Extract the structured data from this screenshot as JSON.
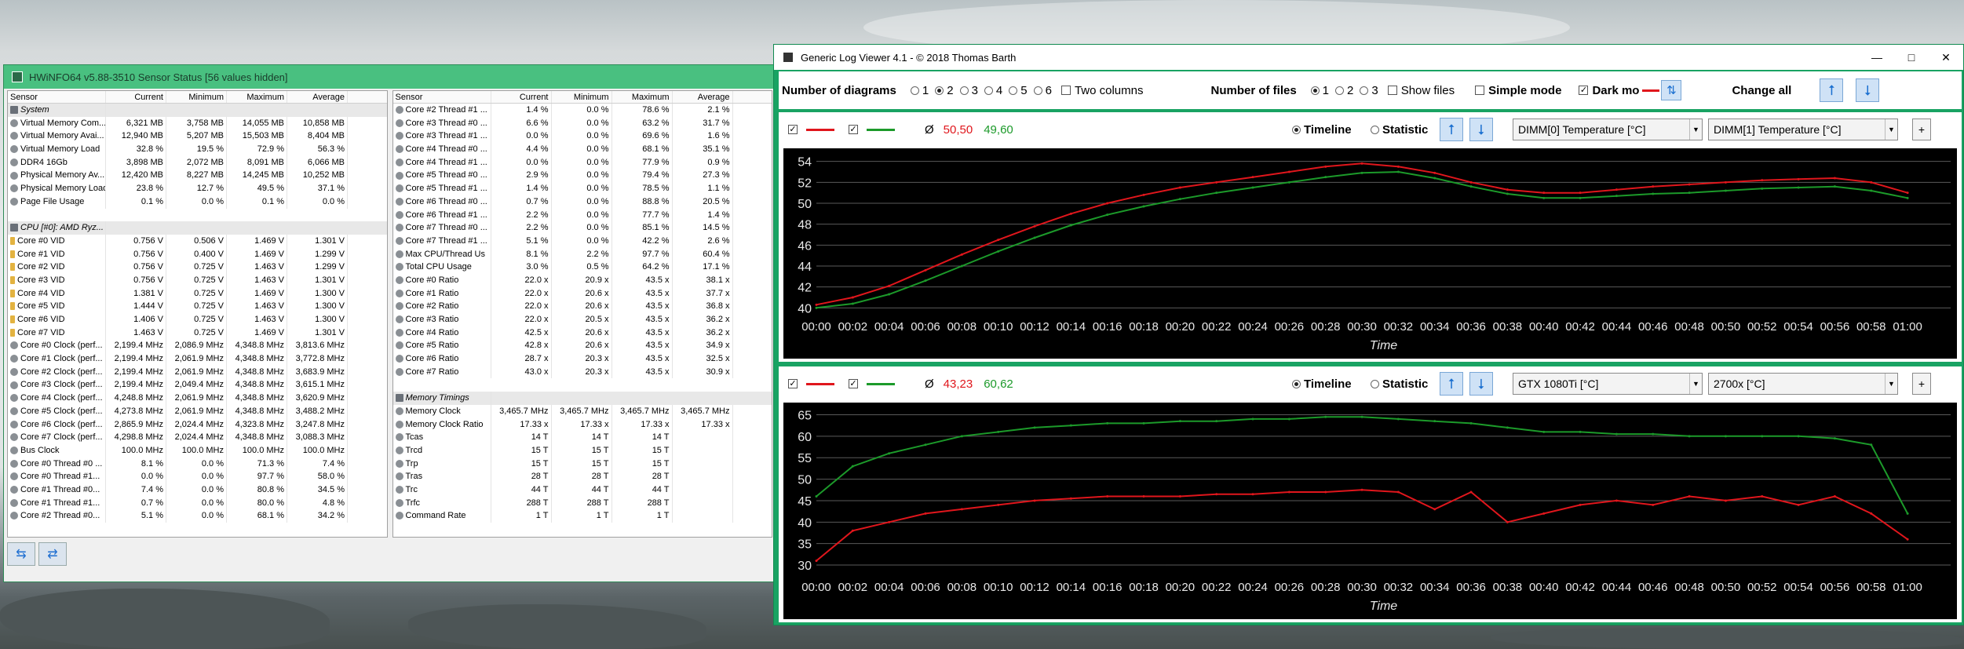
{
  "hwinfo": {
    "title": "HWiNFO64 v5.88-3510 Sensor Status [56 values hidden]",
    "columns": [
      "Sensor",
      "Current",
      "Minimum",
      "Maximum",
      "Average"
    ],
    "left_rows": [
      {
        "type": "group",
        "icon": "computer-icon",
        "name": "System"
      },
      {
        "icon": "gauge-icon",
        "name": "Virtual Memory Com...",
        "cur": "6,321 MB",
        "min": "3,758 MB",
        "max": "14,055 MB",
        "avg": "10,858 MB"
      },
      {
        "icon": "gauge-icon",
        "name": "Virtual Memory Avai...",
        "cur": "12,940 MB",
        "min": "5,207 MB",
        "max": "15,503 MB",
        "avg": "8,404 MB"
      },
      {
        "icon": "gauge-icon",
        "name": "Virtual Memory Load",
        "cur": "32.8 %",
        "min": "19.5 %",
        "max": "72.9 %",
        "avg": "56.3 %"
      },
      {
        "icon": "gauge-icon",
        "name": "DDR4 16Gb",
        "cur": "3,898 MB",
        "min": "2,072 MB",
        "max": "8,091 MB",
        "avg": "6,066 MB"
      },
      {
        "icon": "gauge-icon",
        "name": "Physical Memory Av...",
        "cur": "12,420 MB",
        "min": "8,227 MB",
        "max": "14,245 MB",
        "avg": "10,252 MB"
      },
      {
        "icon": "gauge-icon",
        "name": "Physical Memory Load",
        "cur": "23.8 %",
        "min": "12.7 %",
        "max": "49.5 %",
        "avg": "37.1 %"
      },
      {
        "icon": "gauge-icon",
        "name": "Page File Usage",
        "cur": "0.1 %",
        "min": "0.0 %",
        "max": "0.1 %",
        "avg": "0.0 %"
      },
      {
        "type": "blank"
      },
      {
        "type": "group",
        "icon": "cpu-icon",
        "name": "CPU [#0]: AMD Ryz..."
      },
      {
        "icon": "voltage-icon",
        "name": "Core #0 VID",
        "cur": "0.756 V",
        "min": "0.506 V",
        "max": "1.469 V",
        "avg": "1.301 V"
      },
      {
        "icon": "voltage-icon",
        "name": "Core #1 VID",
        "cur": "0.756 V",
        "min": "0.400 V",
        "max": "1.469 V",
        "avg": "1.299 V"
      },
      {
        "icon": "voltage-icon",
        "name": "Core #2 VID",
        "cur": "0.756 V",
        "min": "0.725 V",
        "max": "1.463 V",
        "avg": "1.299 V"
      },
      {
        "icon": "voltage-icon",
        "name": "Core #3 VID",
        "cur": "0.756 V",
        "min": "0.725 V",
        "max": "1.463 V",
        "avg": "1.301 V"
      },
      {
        "icon": "voltage-icon",
        "name": "Core #4 VID",
        "cur": "1.381 V",
        "min": "0.725 V",
        "max": "1.469 V",
        "avg": "1.300 V"
      },
      {
        "icon": "voltage-icon",
        "name": "Core #5 VID",
        "cur": "1.444 V",
        "min": "0.725 V",
        "max": "1.463 V",
        "avg": "1.300 V"
      },
      {
        "icon": "voltage-icon",
        "name": "Core #6 VID",
        "cur": "1.406 V",
        "min": "0.725 V",
        "max": "1.463 V",
        "avg": "1.300 V"
      },
      {
        "icon": "voltage-icon",
        "name": "Core #7 VID",
        "cur": "1.463 V",
        "min": "0.725 V",
        "max": "1.469 V",
        "avg": "1.301 V"
      },
      {
        "icon": "clock-icon",
        "name": "Core #0 Clock (perf...",
        "cur": "2,199.4 MHz",
        "min": "2,086.9 MHz",
        "max": "4,348.8 MHz",
        "avg": "3,813.6 MHz"
      },
      {
        "icon": "clock-icon",
        "name": "Core #1 Clock (perf...",
        "cur": "2,199.4 MHz",
        "min": "2,061.9 MHz",
        "max": "4,348.8 MHz",
        "avg": "3,772.8 MHz"
      },
      {
        "icon": "clock-icon",
        "name": "Core #2 Clock (perf...",
        "cur": "2,199.4 MHz",
        "min": "2,061.9 MHz",
        "max": "4,348.8 MHz",
        "avg": "3,683.9 MHz"
      },
      {
        "icon": "clock-icon",
        "name": "Core #3 Clock (perf...",
        "cur": "2,199.4 MHz",
        "min": "2,049.4 MHz",
        "max": "4,348.8 MHz",
        "avg": "3,615.1 MHz"
      },
      {
        "icon": "clock-icon",
        "name": "Core #4 Clock (perf...",
        "cur": "4,248.8 MHz",
        "min": "2,061.9 MHz",
        "max": "4,348.8 MHz",
        "avg": "3,620.9 MHz"
      },
      {
        "icon": "clock-icon",
        "name": "Core #5 Clock (perf...",
        "cur": "4,273.8 MHz",
        "min": "2,061.9 MHz",
        "max": "4,348.8 MHz",
        "avg": "3,488.2 MHz"
      },
      {
        "icon": "clock-icon",
        "name": "Core #6 Clock (perf...",
        "cur": "2,865.9 MHz",
        "min": "2,024.4 MHz",
        "max": "4,323.8 MHz",
        "avg": "3,247.8 MHz"
      },
      {
        "icon": "clock-icon",
        "name": "Core #7 Clock (perf...",
        "cur": "4,298.8 MHz",
        "min": "2,024.4 MHz",
        "max": "4,348.8 MHz",
        "avg": "3,088.3 MHz"
      },
      {
        "icon": "clock-icon",
        "name": "Bus Clock",
        "cur": "100.0 MHz",
        "min": "100.0 MHz",
        "max": "100.0 MHz",
        "avg": "100.0 MHz"
      },
      {
        "icon": "gauge-icon",
        "name": "Core #0 Thread #0 ...",
        "cur": "8.1 %",
        "min": "0.0 %",
        "max": "71.3 %",
        "avg": "7.4 %"
      },
      {
        "icon": "gauge-icon",
        "name": "Core #0 Thread #1...",
        "cur": "0.0 %",
        "min": "0.0 %",
        "max": "97.7 %",
        "avg": "58.0 %"
      },
      {
        "icon": "gauge-icon",
        "name": "Core #1 Thread #0...",
        "cur": "7.4 %",
        "min": "0.0 %",
        "max": "80.8 %",
        "avg": "34.5 %"
      },
      {
        "icon": "gauge-icon",
        "name": "Core #1 Thread #1...",
        "cur": "0.7 %",
        "min": "0.0 %",
        "max": "80.0 %",
        "avg": "4.8 %"
      },
      {
        "icon": "gauge-icon",
        "name": "Core #2 Thread #0...",
        "cur": "5.1 %",
        "min": "0.0 %",
        "max": "68.1 %",
        "avg": "34.2 %"
      }
    ],
    "right_rows": [
      {
        "icon": "gauge-icon",
        "name": "Core #2 Thread #1 ...",
        "cur": "1.4 %",
        "min": "0.0 %",
        "max": "78.6 %",
        "avg": "2.1 %"
      },
      {
        "icon": "gauge-icon",
        "name": "Core #3 Thread #0 ...",
        "cur": "6.6 %",
        "min": "0.0 %",
        "max": "63.2 %",
        "avg": "31.7 %"
      },
      {
        "icon": "gauge-icon",
        "name": "Core #3 Thread #1 ...",
        "cur": "0.0 %",
        "min": "0.0 %",
        "max": "69.6 %",
        "avg": "1.6 %"
      },
      {
        "icon": "gauge-icon",
        "name": "Core #4 Thread #0 ...",
        "cur": "4.4 %",
        "min": "0.0 %",
        "max": "68.1 %",
        "avg": "35.1 %"
      },
      {
        "icon": "gauge-icon",
        "name": "Core #4 Thread #1 ...",
        "cur": "0.0 %",
        "min": "0.0 %",
        "max": "77.9 %",
        "avg": "0.9 %"
      },
      {
        "icon": "gauge-icon",
        "name": "Core #5 Thread #0 ...",
        "cur": "2.9 %",
        "min": "0.0 %",
        "max": "79.4 %",
        "avg": "27.3 %"
      },
      {
        "icon": "gauge-icon",
        "name": "Core #5 Thread #1 ...",
        "cur": "1.4 %",
        "min": "0.0 %",
        "max": "78.5 %",
        "avg": "1.1 %"
      },
      {
        "icon": "gauge-icon",
        "name": "Core #6 Thread #0 ...",
        "cur": "0.7 %",
        "min": "0.0 %",
        "max": "88.8 %",
        "avg": "20.5 %"
      },
      {
        "icon": "gauge-icon",
        "name": "Core #6 Thread #1 ...",
        "cur": "2.2 %",
        "min": "0.0 %",
        "max": "77.7 %",
        "avg": "1.4 %"
      },
      {
        "icon": "gauge-icon",
        "name": "Core #7 Thread #0 ...",
        "cur": "2.2 %",
        "min": "0.0 %",
        "max": "85.1 %",
        "avg": "14.5 %"
      },
      {
        "icon": "gauge-icon",
        "name": "Core #7 Thread #1 ...",
        "cur": "5.1 %",
        "min": "0.0 %",
        "max": "42.2 %",
        "avg": "2.6 %"
      },
      {
        "icon": "gauge-icon",
        "name": "Max CPU/Thread Us",
        "cur": "8.1 %",
        "min": "2.2 %",
        "max": "97.7 %",
        "avg": "60.4 %"
      },
      {
        "icon": "gauge-icon",
        "name": "Total CPU Usage",
        "cur": "3.0 %",
        "min": "0.5 %",
        "max": "64.2 %",
        "avg": "17.1 %"
      },
      {
        "icon": "gauge-icon",
        "name": "Core #0 Ratio",
        "cur": "22.0 x",
        "min": "20.9 x",
        "max": "43.5 x",
        "avg": "38.1 x"
      },
      {
        "icon": "gauge-icon",
        "name": "Core #1 Ratio",
        "cur": "22.0 x",
        "min": "20.6 x",
        "max": "43.5 x",
        "avg": "37.7 x"
      },
      {
        "icon": "gauge-icon",
        "name": "Core #2 Ratio",
        "cur": "22.0 x",
        "min": "20.6 x",
        "max": "43.5 x",
        "avg": "36.8 x"
      },
      {
        "icon": "gauge-icon",
        "name": "Core #3 Ratio",
        "cur": "22.0 x",
        "min": "20.5 x",
        "max": "43.5 x",
        "avg": "36.2 x"
      },
      {
        "icon": "gauge-icon",
        "name": "Core #4 Ratio",
        "cur": "42.5 x",
        "min": "20.6 x",
        "max": "43.5 x",
        "avg": "36.2 x"
      },
      {
        "icon": "gauge-icon",
        "name": "Core #5 Ratio",
        "cur": "42.8 x",
        "min": "20.6 x",
        "max": "43.5 x",
        "avg": "34.9 x"
      },
      {
        "icon": "gauge-icon",
        "name": "Core #6 Ratio",
        "cur": "28.7 x",
        "min": "20.3 x",
        "max": "43.5 x",
        "avg": "32.5 x"
      },
      {
        "icon": "gauge-icon",
        "name": "Core #7 Ratio",
        "cur": "43.0 x",
        "min": "20.3 x",
        "max": "43.5 x",
        "avg": "30.9 x"
      },
      {
        "type": "blank"
      },
      {
        "type": "group",
        "icon": "memory-icon",
        "name": "Memory Timings"
      },
      {
        "icon": "clock-icon",
        "name": "Memory Clock",
        "cur": "3,465.7 MHz",
        "min": "3,465.7 MHz",
        "max": "3,465.7 MHz",
        "avg": "3,465.7 MHz"
      },
      {
        "icon": "gauge-icon",
        "name": "Memory Clock Ratio",
        "cur": "17.33 x",
        "min": "17.33 x",
        "max": "17.33 x",
        "avg": "17.33 x"
      },
      {
        "icon": "clock-icon",
        "name": "Tcas",
        "cur": "14 T",
        "min": "14 T",
        "max": "14 T",
        "avg": ""
      },
      {
        "icon": "clock-icon",
        "name": "Trcd",
        "cur": "15 T",
        "min": "15 T",
        "max": "15 T",
        "avg": ""
      },
      {
        "icon": "clock-icon",
        "name": "Trp",
        "cur": "15 T",
        "min": "15 T",
        "max": "15 T",
        "avg": ""
      },
      {
        "icon": "clock-icon",
        "name": "Tras",
        "cur": "28 T",
        "min": "28 T",
        "max": "28 T",
        "avg": ""
      },
      {
        "icon": "clock-icon",
        "name": "Trc",
        "cur": "44 T",
        "min": "44 T",
        "max": "44 T",
        "avg": ""
      },
      {
        "icon": "clock-icon",
        "name": "Trfc",
        "cur": "288 T",
        "min": "288 T",
        "max": "288 T",
        "avg": ""
      },
      {
        "icon": "clock-icon",
        "name": "Command Rate",
        "cur": "1 T",
        "min": "1 T",
        "max": "1 T",
        "avg": ""
      }
    ],
    "bottom_buttons": [
      "arrows-left-right-icon",
      "arrows-right-left-icon"
    ]
  },
  "logviewer": {
    "title": "Generic Log Viewer 4.1 - © 2018 Thomas Barth",
    "window_buttons": [
      "minimize-icon",
      "maximize-icon",
      "close-icon"
    ],
    "toolbar": {
      "num_diagrams_label": "Number of diagrams",
      "diagram_options": [
        "1",
        "2",
        "3",
        "4",
        "5",
        "6"
      ],
      "diagram_selected": "2",
      "two_columns_label": "Two columns",
      "num_files_label": "Number of files",
      "file_options": [
        "1",
        "2",
        "3"
      ],
      "file_selected": "1",
      "show_files_label": "Show files",
      "simple_mode_label": "Simple mode",
      "dark_mode_label": "Dark mo",
      "change_all_label": "Change all"
    },
    "avg_symbol": "Ø",
    "timeline_label": "Timeline",
    "statistic_label": "Statistic",
    "colors": {
      "red": "#e0161c",
      "green": "#1c9a2a"
    },
    "diagram1": {
      "avg_red": "50,50",
      "avg_green": "49,60",
      "sensor1": "DIMM[0] Temperature [°C]",
      "sensor2": "DIMM[1] Temperature [°C]"
    },
    "diagram2": {
      "avg_red": "43,23",
      "avg_green": "60,62",
      "sensor1": "GTX 1080Ti [°C]",
      "sensor2": "2700x [°C]"
    }
  },
  "chart_data": [
    {
      "type": "line",
      "xlabel": "Time",
      "x": [
        "00:00",
        "00:02",
        "00:04",
        "00:06",
        "00:08",
        "00:10",
        "00:12",
        "00:14",
        "00:16",
        "00:18",
        "00:20",
        "00:22",
        "00:24",
        "00:26",
        "00:28",
        "00:30",
        "00:32",
        "00:34",
        "00:36",
        "00:38",
        "00:40",
        "00:42",
        "00:44",
        "00:46",
        "00:48",
        "00:50",
        "00:52",
        "00:54",
        "00:56",
        "00:58",
        "01:00"
      ],
      "yticks": [
        40,
        42,
        44,
        46,
        48,
        50,
        52,
        54
      ],
      "ylim": [
        39.5,
        54.5
      ],
      "grid": true,
      "series": [
        {
          "color": "red",
          "values": [
            40.3,
            41.0,
            42.1,
            43.6,
            45.1,
            46.5,
            47.8,
            49.0,
            50.0,
            50.8,
            51.5,
            52.0,
            52.5,
            53.0,
            53.5,
            53.8,
            53.5,
            52.9,
            52.0,
            51.3,
            51.0,
            51.0,
            51.3,
            51.6,
            51.8,
            52.0,
            52.2,
            52.3,
            52.4,
            52.0,
            51.0
          ]
        },
        {
          "color": "green",
          "values": [
            40.0,
            40.4,
            41.3,
            42.6,
            44.0,
            45.4,
            46.7,
            47.9,
            48.9,
            49.7,
            50.4,
            51.0,
            51.5,
            52.0,
            52.5,
            52.9,
            53.0,
            52.4,
            51.6,
            50.9,
            50.5,
            50.5,
            50.7,
            50.9,
            51.0,
            51.2,
            51.4,
            51.5,
            51.6,
            51.2,
            50.5
          ]
        }
      ]
    },
    {
      "type": "line",
      "xlabel": "Time",
      "x": [
        "00:00",
        "00:02",
        "00:04",
        "00:06",
        "00:08",
        "00:10",
        "00:12",
        "00:14",
        "00:16",
        "00:18",
        "00:20",
        "00:22",
        "00:24",
        "00:26",
        "00:28",
        "00:30",
        "00:32",
        "00:34",
        "00:36",
        "00:38",
        "00:40",
        "00:42",
        "00:44",
        "00:46",
        "00:48",
        "00:50",
        "00:52",
        "00:54",
        "00:56",
        "00:58",
        "01:00"
      ],
      "yticks": [
        30,
        35,
        40,
        45,
        50,
        55,
        60,
        65
      ],
      "ylim": [
        28,
        66
      ],
      "grid": true,
      "series": [
        {
          "color": "green",
          "values": [
            46,
            53,
            56,
            58,
            60,
            61,
            62,
            62.5,
            63,
            63,
            63.5,
            63.5,
            64,
            64,
            64.5,
            64.5,
            64,
            63.5,
            63,
            62,
            61,
            61,
            60.5,
            60.5,
            60,
            60,
            60,
            60,
            59.5,
            58,
            42
          ]
        },
        {
          "color": "red",
          "values": [
            31,
            38,
            40,
            42,
            43,
            44,
            45,
            45.5,
            46,
            46,
            46,
            46.5,
            46.5,
            47,
            47,
            47.5,
            47,
            43,
            47,
            40,
            42,
            44,
            45,
            44,
            46,
            45,
            46,
            44,
            46,
            42,
            36
          ]
        }
      ]
    }
  ]
}
